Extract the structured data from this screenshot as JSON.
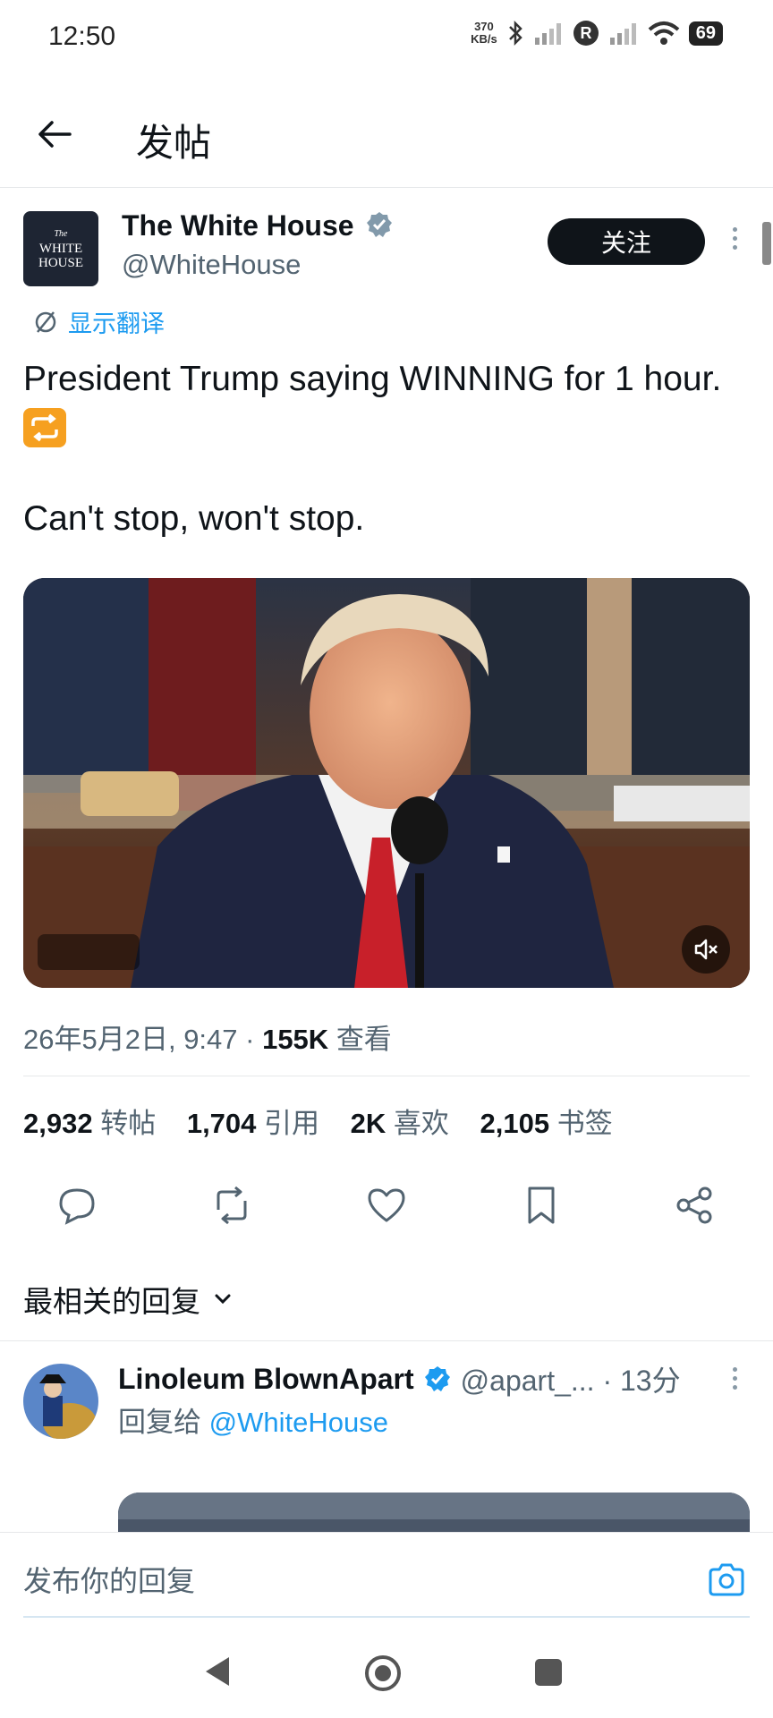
{
  "status_bar": {
    "time": "12:50",
    "net_speed_value": "370",
    "net_speed_unit": "KB/s",
    "battery": "69"
  },
  "header": {
    "title": "发帖"
  },
  "tweet": {
    "author": {
      "name": "The White House",
      "handle": "@WhiteHouse",
      "verified": true,
      "avatar_text_1": "The",
      "avatar_text_2": "WHITE",
      "avatar_text_3": "HOUSE"
    },
    "follow_label": "关注",
    "translate_label": "显示翻译",
    "text_line_1": "President Trump saying WINNING for 1 hour.",
    "text_line_2": "Can't stop, won't stop.",
    "timestamp": "26年5月2日, 9:47 · ",
    "views_count": "155K",
    "views_label": "查看",
    "stats": {
      "reposts_count": "2,932",
      "reposts_label": "转帖",
      "quotes_count": "1,704",
      "quotes_label": "引用",
      "likes_count": "2K",
      "likes_label": "喜欢",
      "bookmarks_count": "2,105",
      "bookmarks_label": "书签"
    }
  },
  "replies_sort_label": "最相关的回复",
  "reply": {
    "name": "Linoleum BlownApart",
    "handle_time": "@apart_... · 13分",
    "reply_prefix": "回复给",
    "reply_target": "@WhiteHouse"
  },
  "compose": {
    "placeholder": "发布你的回复"
  },
  "icons": {
    "back": "arrow-left-icon",
    "verified": "verified-badge-icon",
    "translate": "translate-icon",
    "mute": "volume-mute-icon",
    "reply": "comment-icon",
    "repost": "repost-icon",
    "like": "heart-icon",
    "bookmark": "bookmark-icon",
    "share": "share-icon",
    "camera": "camera-icon"
  },
  "colors": {
    "accent": "#1d9bf0",
    "text_primary": "#0f1419",
    "text_secondary": "#536471"
  }
}
